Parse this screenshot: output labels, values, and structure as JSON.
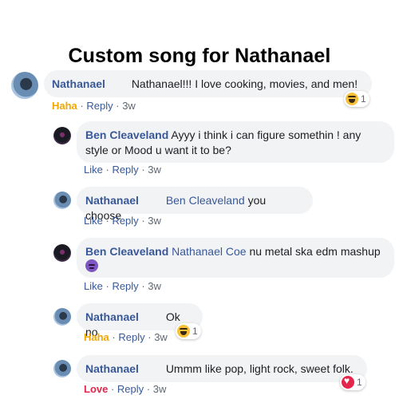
{
  "title": "Custom song for Nathanael",
  "comments": [
    {
      "author": "Nathanael",
      "text": "Nathanael!!! I love cooking, movies, and men!",
      "reaction_label": "Haha",
      "reply": "Reply",
      "time": "3w",
      "reaction_icon": "haha-emoji-icon",
      "reaction_count": "1"
    },
    {
      "author": "Ben Cleaveland",
      "text_line1": "Ayyy i think i can figure somethin ! any",
      "text_line2": "style or Mood u want it to be?",
      "like": "Like",
      "reply": "Reply",
      "time": "3w"
    },
    {
      "author": "Nathanael",
      "mention": "Ben Cleaveland",
      "text": "you choose",
      "like": "Like",
      "reply": "Reply",
      "time": "3w"
    },
    {
      "author": "Ben Cleaveland",
      "mention": "Nathanael Coe",
      "text": "nu metal ska edm mashup",
      "emoji": "devil-emoji-icon",
      "like": "Like",
      "reply": "Reply",
      "time": "3w"
    },
    {
      "author": "Nathanael",
      "text": "Ok no",
      "reaction_label": "Haha",
      "reply": "Reply",
      "time": "3w",
      "reaction_icon": "haha-emoji-icon",
      "reaction_count": "1"
    },
    {
      "author": "Nathanael",
      "text": "Ummm like pop, light rock, sweet folk.",
      "reaction_label": "Love",
      "reply": "Reply",
      "time": "3w",
      "reaction_icon": "love-heart-icon",
      "reaction_count": "1"
    }
  ],
  "colors": {
    "name": "#385898",
    "bubble": "#f2f3f5",
    "haha": "#f0a700",
    "love": "#e5254b"
  }
}
